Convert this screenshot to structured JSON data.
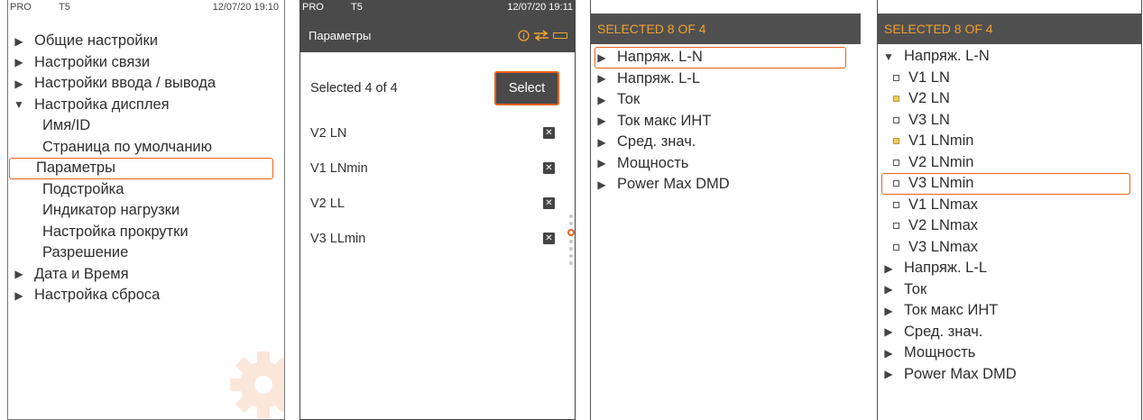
{
  "status": {
    "mode": "PRO",
    "terminal": "T5"
  },
  "panel1": {
    "datetime": "12/07/20 19:10",
    "menu": [
      {
        "label": "Общие настройки",
        "expanded": false
      },
      {
        "label": "Настройки связи",
        "expanded": false
      },
      {
        "label": "Настройки ввода / вывода",
        "expanded": false
      },
      {
        "label": "Настройка дисплея",
        "expanded": true
      }
    ],
    "submenu": [
      "Имя/ID",
      "Страница по умолчанию",
      "Параметры",
      "Подстройка",
      "Индикатор нагрузки",
      "Настройка прокрутки",
      "Разрешение"
    ],
    "selected_submenu": "Параметры",
    "menu_after": [
      {
        "label": "Дата и Время",
        "expanded": false
      },
      {
        "label": "Настройка сброса",
        "expanded": false
      }
    ]
  },
  "panel2": {
    "datetime": "12/07/20 19:11",
    "title": "Параметры",
    "icons": [
      "info-icon",
      "swap-icon",
      "battery-icon"
    ],
    "selected_count": "Selected 4 of 4",
    "select_label": "Select",
    "params": [
      {
        "label": "V2 LN",
        "checked": true
      },
      {
        "label": "V1 LNmin",
        "checked": true
      },
      {
        "label": "V2 LL",
        "checked": true
      },
      {
        "label": "V3 LLmin",
        "checked": true
      }
    ],
    "pager": {
      "pages": 7,
      "active": 2
    }
  },
  "panel3": {
    "header": "SELECTED 8 OF 4",
    "groups": [
      "Напряж. L-N",
      "Напряж. L-L",
      "Ток",
      "Ток макс ИНТ",
      "Сред. знач.",
      "Мощность",
      "Power Max DMD"
    ],
    "highlighted": "Напряж. L-N"
  },
  "panel4": {
    "header": "SELECTED 8 OF 4",
    "expanded_group": "Напряж. L-N",
    "items": [
      {
        "label": "V1 LN",
        "checked": false
      },
      {
        "label": "V2 LN",
        "checked": true
      },
      {
        "label": "V3 LN",
        "checked": false
      },
      {
        "label": "V1 LNmin",
        "checked": true
      },
      {
        "label": "V2 LNmin",
        "checked": false
      },
      {
        "label": "V3 LNmin",
        "checked": false
      },
      {
        "label": "V1 LNmax",
        "checked": false
      },
      {
        "label": "V2 LNmax",
        "checked": false
      },
      {
        "label": "V3 LNmax",
        "checked": false
      }
    ],
    "highlighted": "V3 LNmin",
    "groups_after": [
      "Напряж. L-L",
      "Ток",
      "Ток макс ИНТ",
      "Сред. знач.",
      "Мощность",
      "Power Max DMD"
    ]
  },
  "colors": {
    "accent": "#e8611e",
    "header_bg": "#4a4a4a",
    "header_text": "#f0a030",
    "gear": "#fbe6da"
  }
}
